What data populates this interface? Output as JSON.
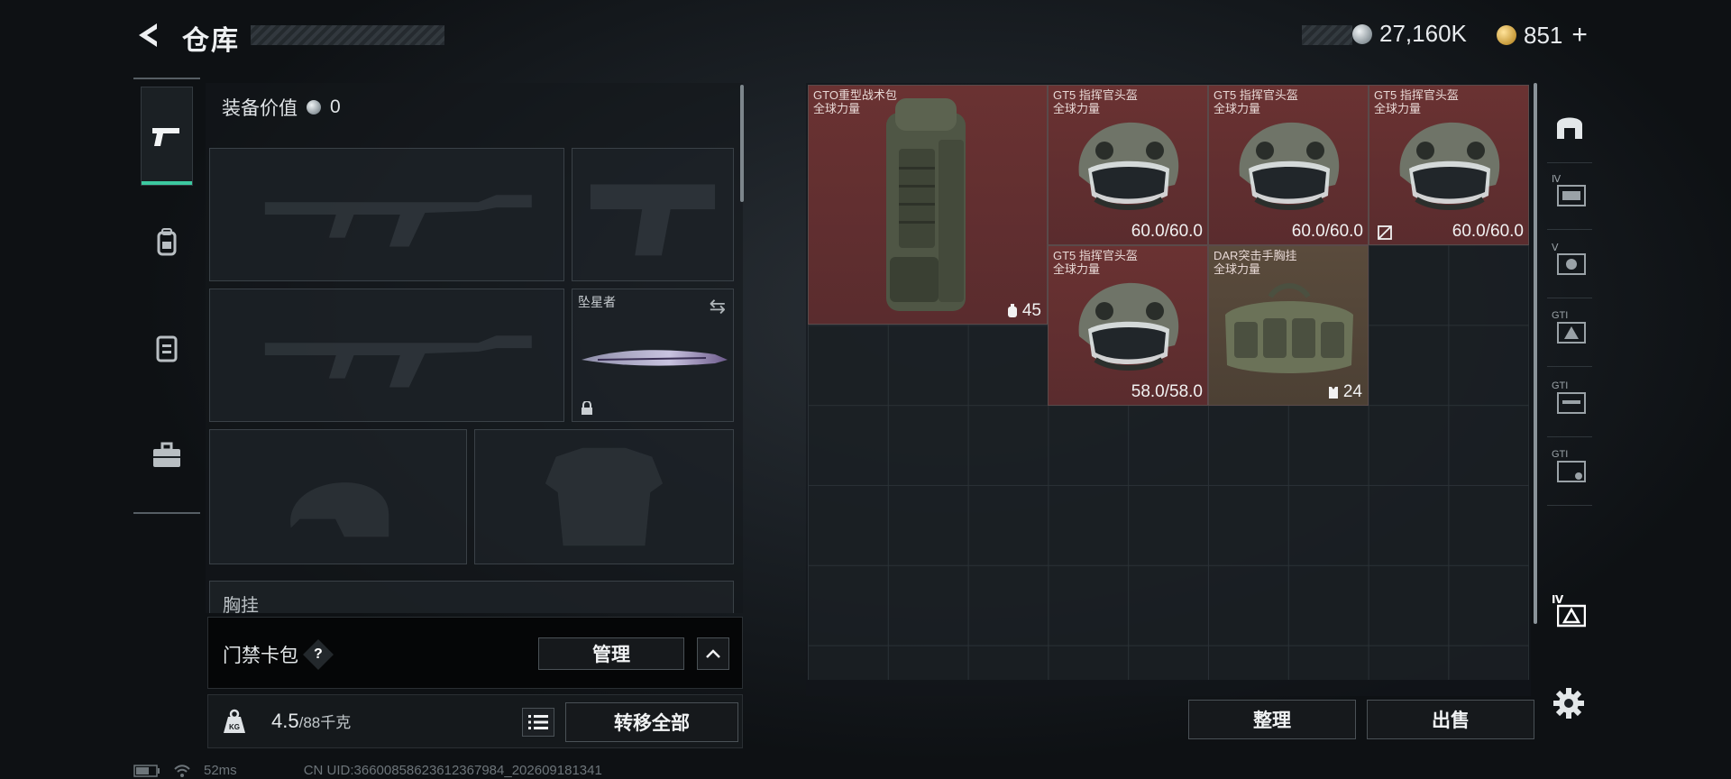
{
  "header": {
    "title": "仓库"
  },
  "currency": {
    "silver": "27,160K",
    "gold": "851",
    "plus": "+"
  },
  "equipment": {
    "value_label": "装备价值",
    "value": "0",
    "knife_slot_name": "坠星者",
    "chest_label": "胸挂"
  },
  "keycard": {
    "label": "门禁卡包",
    "help": "?",
    "manage": "管理"
  },
  "weight": {
    "current": "4.5",
    "max": "/88千克",
    "icon": "KG",
    "transfer_all": "转移全部"
  },
  "status": {
    "latency": "52ms",
    "uid": "CN UID:366008586236123679​84_202609181341"
  },
  "storage": {
    "items": [
      {
        "name": "GTO重型战术包",
        "sub": "全球力量",
        "count": "45",
        "count_icon": "backpack-icon"
      },
      {
        "name": "GT5 指挥官头盔",
        "sub": "全球力量",
        "durability": "60.0/60.0"
      },
      {
        "name": "GT5 指挥官头盔",
        "sub": "全球力量",
        "durability": "60.0/60.0"
      },
      {
        "name": "GT5 指挥官头盔",
        "sub": "全球力量",
        "durability": "60.0/60.0"
      },
      {
        "name": "GT5 指挥官头盔",
        "sub": "全球力量",
        "durability": "58.0/58.0"
      },
      {
        "name": "DAR突击手胸挂",
        "sub": "全球力量",
        "count": "24",
        "count_icon": "vest-icon"
      }
    ],
    "sort": "整理",
    "sell": "出售"
  },
  "side_tabs": [
    "Ⅳ",
    "Ⅴ",
    "GTI",
    "GTI",
    "GTI",
    "Ⅳ"
  ],
  "colors": {
    "accent": "#3cc9a0",
    "item_red": "#6a3232",
    "item_tan": "#5a4b3c"
  }
}
